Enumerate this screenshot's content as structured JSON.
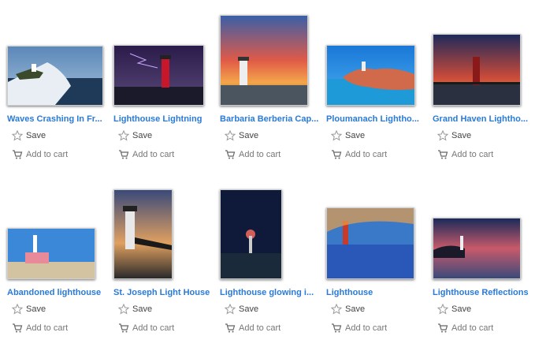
{
  "products": [
    {
      "title": "Waves Crashing In Fr...",
      "save_label": "Save",
      "cart_label": "Add to cart"
    },
    {
      "title": "Lighthouse Lightning",
      "save_label": "Save",
      "cart_label": "Add to cart"
    },
    {
      "title": "Barbaria Berberia Cap...",
      "save_label": "Save",
      "cart_label": "Add to cart"
    },
    {
      "title": "Ploumanach Lightho...",
      "save_label": "Save",
      "cart_label": "Add to cart"
    },
    {
      "title": "Grand Haven Lightho...",
      "save_label": "Save",
      "cart_label": "Add to cart"
    },
    {
      "title": "Abandoned lighthouse",
      "save_label": "Save",
      "cart_label": "Add to cart"
    },
    {
      "title": "St. Joseph Light House",
      "save_label": "Save",
      "cart_label": "Add to cart"
    },
    {
      "title": "Lighthouse glowing i...",
      "save_label": "Save",
      "cart_label": "Add to cart"
    },
    {
      "title": "Lighthouse",
      "save_label": "Save",
      "cart_label": "Add to cart"
    },
    {
      "title": "Lighthouse Reflections",
      "save_label": "Save",
      "cart_label": "Add to cart"
    }
  ],
  "colors": {
    "link": "#2a7ad6",
    "text": "#444444",
    "muted": "#777777"
  },
  "icons": {
    "save": "star-icon",
    "cart": "cart-icon"
  }
}
